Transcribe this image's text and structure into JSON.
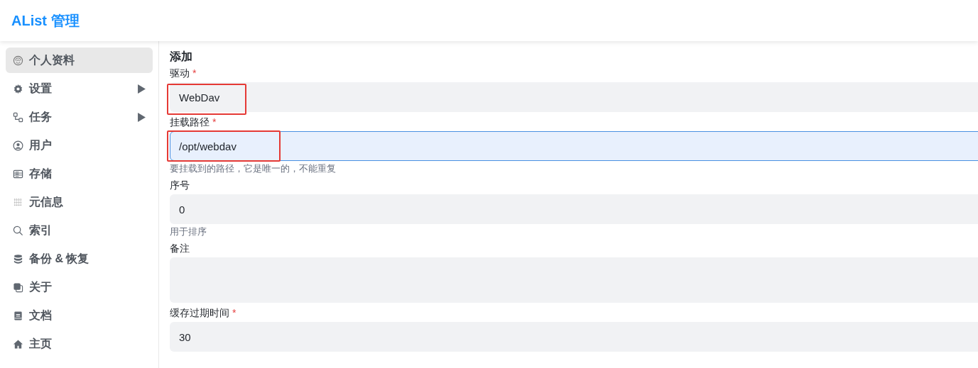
{
  "header": {
    "title": "AList 管理"
  },
  "sidebar": {
    "items": [
      {
        "label": "个人资料",
        "selected": true,
        "expandable": false
      },
      {
        "label": "设置",
        "selected": false,
        "expandable": true
      },
      {
        "label": "任务",
        "selected": false,
        "expandable": true
      },
      {
        "label": "用户",
        "selected": false,
        "expandable": false
      },
      {
        "label": "存储",
        "selected": false,
        "expandable": false
      },
      {
        "label": "元信息",
        "selected": false,
        "expandable": false
      },
      {
        "label": "索引",
        "selected": false,
        "expandable": false
      },
      {
        "label": "备份 & 恢复",
        "selected": false,
        "expandable": false
      },
      {
        "label": "关于",
        "selected": false,
        "expandable": false
      },
      {
        "label": "文档",
        "selected": false,
        "expandable": false
      },
      {
        "label": "主页",
        "selected": false,
        "expandable": false
      }
    ]
  },
  "form": {
    "title": "添加",
    "fields": [
      {
        "kind": "select",
        "label": "驱动",
        "required_mark": "*",
        "value": "WebDav",
        "focused": false,
        "highlighted": true
      },
      {
        "kind": "input",
        "label": "挂载路径",
        "required_mark": "*",
        "value": "/opt/webdav",
        "focused": true,
        "highlighted": true,
        "help": "要挂载到的路径，它是唯一的，不能重复"
      },
      {
        "kind": "input",
        "label": "序号",
        "value": "0",
        "focused": false,
        "help": "用于排序"
      },
      {
        "kind": "textarea",
        "label": "备注",
        "focused": false
      },
      {
        "kind": "input",
        "label": "缓存过期时间",
        "required_mark": "*",
        "value": "30",
        "focused": false
      }
    ]
  }
}
